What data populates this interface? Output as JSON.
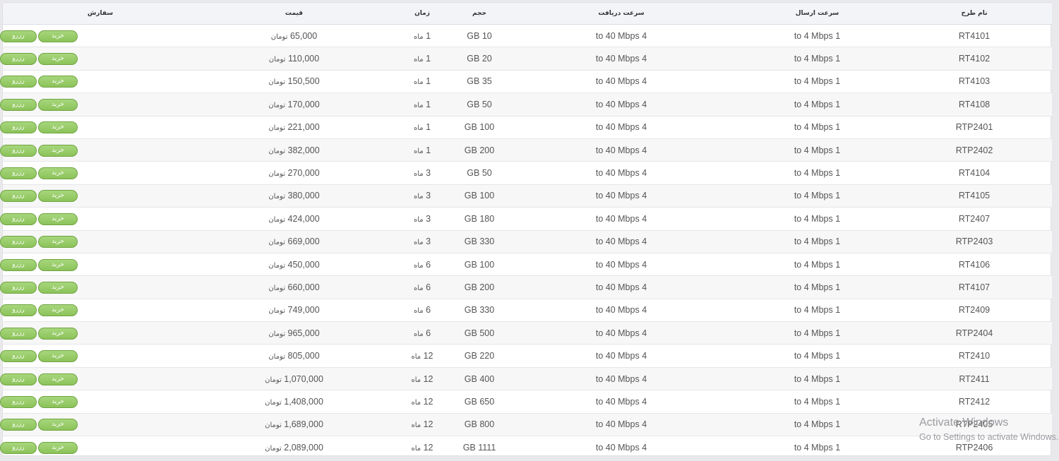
{
  "table": {
    "headers": {
      "plan_name": "نام طرح",
      "upload_speed": "سرعت ارسال",
      "download_speed": "سرعت دریافت",
      "volume": "حجم",
      "duration": "زمان",
      "price": "قیمت",
      "order": "سفارش"
    },
    "buy_label": "خرید",
    "reserve_label": "رزرو",
    "rows": [
      {
        "name": "RT4101",
        "upload": "1 to 4 Mbps",
        "download": "4 to 40 Mbps",
        "volume": "10 GB",
        "duration_num": "1",
        "duration_unit": "ماه",
        "price_num": "65,000",
        "price_unit": "تومان"
      },
      {
        "name": "RT4102",
        "upload": "1 to 4 Mbps",
        "download": "4 to 40 Mbps",
        "volume": "20 GB",
        "duration_num": "1",
        "duration_unit": "ماه",
        "price_num": "110,000",
        "price_unit": "تومان"
      },
      {
        "name": "RT4103",
        "upload": "1 to 4 Mbps",
        "download": "4 to 40 Mbps",
        "volume": "35 GB",
        "duration_num": "1",
        "duration_unit": "ماه",
        "price_num": "150,500",
        "price_unit": "تومان"
      },
      {
        "name": "RT4108",
        "upload": "1 to 4 Mbps",
        "download": "4 to 40 Mbps",
        "volume": "50 GB",
        "duration_num": "1",
        "duration_unit": "ماه",
        "price_num": "170,000",
        "price_unit": "تومان"
      },
      {
        "name": "RTP2401",
        "upload": "1 to 4 Mbps",
        "download": "4 to 40 Mbps",
        "volume": "100 GB",
        "duration_num": "1",
        "duration_unit": "ماه",
        "price_num": "221,000",
        "price_unit": "تومان"
      },
      {
        "name": "RTP2402",
        "upload": "1 to 4 Mbps",
        "download": "4 to 40 Mbps",
        "volume": "200 GB",
        "duration_num": "1",
        "duration_unit": "ماه",
        "price_num": "382,000",
        "price_unit": "تومان"
      },
      {
        "name": "RT4104",
        "upload": "1 to 4 Mbps",
        "download": "4 to 40 Mbps",
        "volume": "50 GB",
        "duration_num": "3",
        "duration_unit": "ماه",
        "price_num": "270,000",
        "price_unit": "تومان"
      },
      {
        "name": "RT4105",
        "upload": "1 to 4 Mbps",
        "download": "4 to 40 Mbps",
        "volume": "100 GB",
        "duration_num": "3",
        "duration_unit": "ماه",
        "price_num": "380,000",
        "price_unit": "تومان"
      },
      {
        "name": "RT2407",
        "upload": "1 to 4 Mbps",
        "download": "4 to 40 Mbps",
        "volume": "180 GB",
        "duration_num": "3",
        "duration_unit": "ماه",
        "price_num": "424,000",
        "price_unit": "تومان"
      },
      {
        "name": "RTP2403",
        "upload": "1 to 4 Mbps",
        "download": "4 to 40 Mbps",
        "volume": "330 GB",
        "duration_num": "3",
        "duration_unit": "ماه",
        "price_num": "669,000",
        "price_unit": "تومان"
      },
      {
        "name": "RT4106",
        "upload": "1 to 4 Mbps",
        "download": "4 to 40 Mbps",
        "volume": "100 GB",
        "duration_num": "6",
        "duration_unit": "ماه",
        "price_num": "450,000",
        "price_unit": "تومان"
      },
      {
        "name": "RT4107",
        "upload": "1 to 4 Mbps",
        "download": "4 to 40 Mbps",
        "volume": "200 GB",
        "duration_num": "6",
        "duration_unit": "ماه",
        "price_num": "660,000",
        "price_unit": "تومان"
      },
      {
        "name": "RT2409",
        "upload": "1 to 4 Mbps",
        "download": "4 to 40 Mbps",
        "volume": "330 GB",
        "duration_num": "6",
        "duration_unit": "ماه",
        "price_num": "749,000",
        "price_unit": "تومان"
      },
      {
        "name": "RTP2404",
        "upload": "1 to 4 Mbps",
        "download": "4 to 40 Mbps",
        "volume": "500 GB",
        "duration_num": "6",
        "duration_unit": "ماه",
        "price_num": "965,000",
        "price_unit": "تومان"
      },
      {
        "name": "RT2410",
        "upload": "1 to 4 Mbps",
        "download": "4 to 40 Mbps",
        "volume": "220 GB",
        "duration_num": "12",
        "duration_unit": "ماه",
        "price_num": "805,000",
        "price_unit": "تومان"
      },
      {
        "name": "RT2411",
        "upload": "1 to 4 Mbps",
        "download": "4 to 40 Mbps",
        "volume": "400 GB",
        "duration_num": "12",
        "duration_unit": "ماه",
        "price_num": "1,070,000",
        "price_unit": "تومان"
      },
      {
        "name": "RT2412",
        "upload": "1 to 4 Mbps",
        "download": "4 to 40 Mbps",
        "volume": "650 GB",
        "duration_num": "12",
        "duration_unit": "ماه",
        "price_num": "1,408,000",
        "price_unit": "تومان"
      },
      {
        "name": "RTP2405",
        "upload": "1 to 4 Mbps",
        "download": "4 to 40 Mbps",
        "volume": "800 GB",
        "duration_num": "12",
        "duration_unit": "ماه",
        "price_num": "1,689,000",
        "price_unit": "تومان"
      },
      {
        "name": "RTP2406",
        "upload": "1 to 4 Mbps",
        "download": "4 to 40 Mbps",
        "volume": "1111 GB",
        "duration_num": "12",
        "duration_unit": "ماه",
        "price_num": "2,089,000",
        "price_unit": "تومان"
      }
    ]
  },
  "watermark": {
    "title": "Activate Windows",
    "subtitle": "Go to Settings to activate Windows."
  },
  "colors": {
    "button_green": "#9ccd6d",
    "header_bg": "#f3f4f8",
    "row_alt_bg": "#f7f7f7"
  }
}
